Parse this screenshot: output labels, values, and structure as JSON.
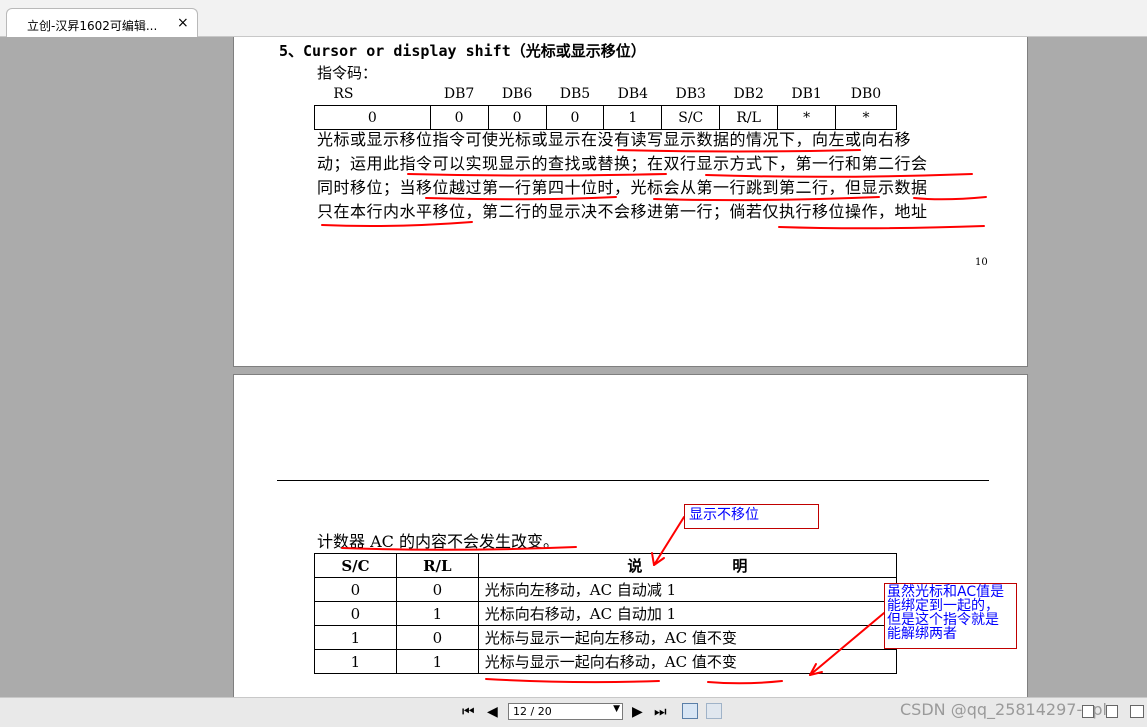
{
  "tab": {
    "title": "立创-汉昇1602可编辑...",
    "close": "×"
  },
  "page1": {
    "section_title": "5、Cursor or display shift（光标或显示移位）",
    "code_label": "指令码：",
    "db_headers": [
      "RS",
      "",
      "DB7",
      "DB6",
      "DB5",
      "DB4",
      "DB3",
      "DB2",
      "DB1",
      "DB0"
    ],
    "db_values": [
      "0",
      "",
      "0",
      "0",
      "0",
      "1",
      "S/C",
      "R/L",
      "*",
      "*"
    ],
    "para_lines": [
      "光标或显示移位指令可使光标或显示在没有读写显示数据的情况下，向左或向右移",
      "动；运用此指令可以实现显示的查找或替换；在双行显示方式下，第一行和第二行会",
      "同时移位；当移位越过第一行第四十位时，光标会从第一行跳到第二行，但显示数据",
      "只在本行内水平移位，第二行的显示决不会移进第一行；倘若仅执行移位操作，地址"
    ],
    "page_number": "10"
  },
  "page2": {
    "ac_note": "计数器 AC 的内容不会发生改变。",
    "table_headers": [
      "S/C",
      "R/L",
      "说　　　　　　明"
    ],
    "table_rows": [
      [
        "0",
        "0",
        "光标向左移动，AC 自动减 1"
      ],
      [
        "0",
        "1",
        "光标向右移动，AC 自动加 1"
      ],
      [
        "1",
        "0",
        "光标与显示一起向左移动，AC 值不变"
      ],
      [
        "1",
        "1",
        "光标与显示一起向右移动，AC 值不变"
      ]
    ],
    "annotation1": "显示不移位",
    "annotation2_lines": [
      "虽然光标和AC值是",
      "能绑定到一起的，",
      "但是这个指令就是",
      "能解绑两者"
    ]
  },
  "bottombar": {
    "page_field": "12 / 20",
    "watermark": "CSDN @qq_25814297-npl"
  },
  "colors": {
    "annotation_border": "#c00000",
    "annotation_text": "#0000ff",
    "underline": "#ff0000"
  }
}
